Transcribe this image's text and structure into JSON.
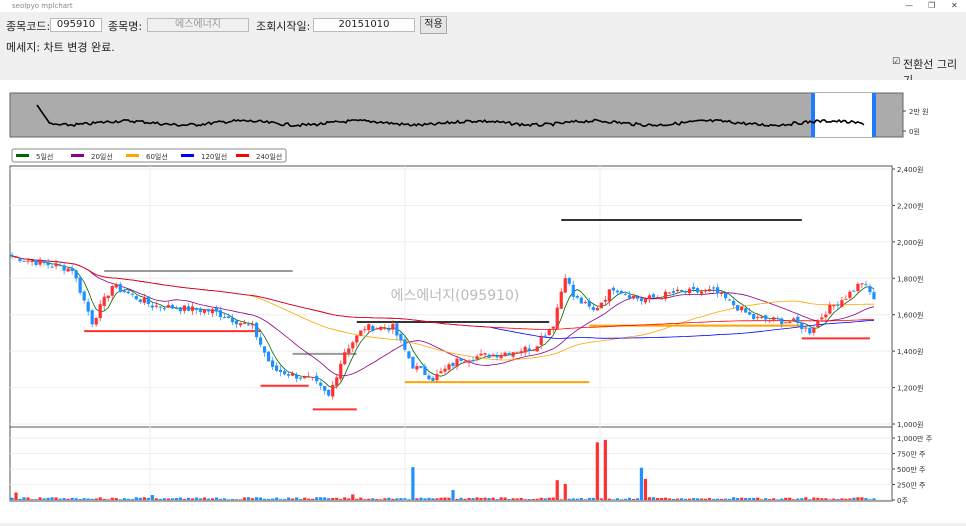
{
  "window": {
    "title": "seolpyo mplchart",
    "minimize": "—",
    "restore": "❐",
    "close": "✕"
  },
  "form": {
    "code_label": "종목코드:",
    "code_value": "095910",
    "name_label": "종목명:",
    "name_value": "에스에너지",
    "date_label": "조회시작일:",
    "date_value": "20151010",
    "apply_button": "적용",
    "message": "메세지: 차트 변경 완료.",
    "transition_checkbox": "전환선 그리기",
    "transition_checked": true
  },
  "chart_data": {
    "type": "candlestick",
    "watermark": "에스에너지(095910)",
    "legend": [
      {
        "name": "5일선",
        "color": "#006400"
      },
      {
        "name": "20일선",
        "color": "#8b008b"
      },
      {
        "name": "60일선",
        "color": "#ffa500"
      },
      {
        "name": "120일선",
        "color": "#0000ff"
      },
      {
        "name": "240일선",
        "color": "#ff0000"
      }
    ],
    "price_ticks": [
      "2,400원",
      "2,200원",
      "2,000원",
      "1,800원",
      "1,600원",
      "1,400원",
      "1,200원",
      "1,000원"
    ],
    "price_range": [
      1000,
      2400
    ],
    "volume_ticks": [
      "1,000만 주",
      "750만 주",
      "500만 주",
      "250만 주",
      "0주"
    ],
    "volume_range": [
      0,
      1000
    ],
    "overview_ticks": [
      "2만 원",
      "0원"
    ],
    "close_keypoints": [
      [
        0,
        1920
      ],
      [
        8,
        1880
      ],
      [
        15,
        1850
      ],
      [
        20,
        1560
      ],
      [
        25,
        1760
      ],
      [
        35,
        1650
      ],
      [
        50,
        1620
      ],
      [
        60,
        1530
      ],
      [
        65,
        1300
      ],
      [
        75,
        1240
      ],
      [
        79,
        1150
      ],
      [
        83,
        1400
      ],
      [
        88,
        1530
      ],
      [
        95,
        1530
      ],
      [
        100,
        1320
      ],
      [
        105,
        1250
      ],
      [
        112,
        1360
      ],
      [
        120,
        1380
      ],
      [
        130,
        1420
      ],
      [
        135,
        1550
      ],
      [
        138,
        1820
      ],
      [
        140,
        1700
      ],
      [
        145,
        1620
      ],
      [
        150,
        1750
      ],
      [
        157,
        1680
      ],
      [
        165,
        1720
      ],
      [
        175,
        1730
      ],
      [
        185,
        1580
      ],
      [
        195,
        1560
      ],
      [
        199,
        1510
      ],
      [
        203,
        1620
      ],
      [
        208,
        1700
      ],
      [
        212,
        1780
      ],
      [
        215,
        1690
      ]
    ],
    "volume_spikes": [
      [
        1,
        120
      ],
      [
        100,
        530
      ],
      [
        110,
        160
      ],
      [
        136,
        320
      ],
      [
        138,
        260
      ],
      [
        146,
        930
      ],
      [
        148,
        970
      ],
      [
        157,
        520
      ],
      [
        158,
        340
      ],
      [
        85,
        90
      ],
      [
        35,
        80
      ]
    ],
    "support_lines": [
      {
        "from": 23,
        "to": 70,
        "price": 1840,
        "color": "#999999"
      },
      {
        "from": 18,
        "to": 62,
        "price": 1510,
        "color": "#ff3030"
      },
      {
        "from": 62,
        "to": 74,
        "price": 1210,
        "color": "#ff3030"
      },
      {
        "from": 75,
        "to": 86,
        "price": 1080,
        "color": "#ff3030"
      },
      {
        "from": 70,
        "to": 86,
        "price": 1385,
        "color": "#999999"
      },
      {
        "from": 86,
        "to": 134,
        "price": 1560,
        "color": "#333333"
      },
      {
        "from": 98,
        "to": 144,
        "price": 1230,
        "color": "#ffa500"
      },
      {
        "from": 137,
        "to": 197,
        "price": 2120,
        "color": "#333333"
      },
      {
        "from": 144,
        "to": 197,
        "price": 1540,
        "color": "#ffa500"
      },
      {
        "from": 197,
        "to": 214,
        "price": 1470,
        "color": "#ff3030"
      }
    ]
  }
}
